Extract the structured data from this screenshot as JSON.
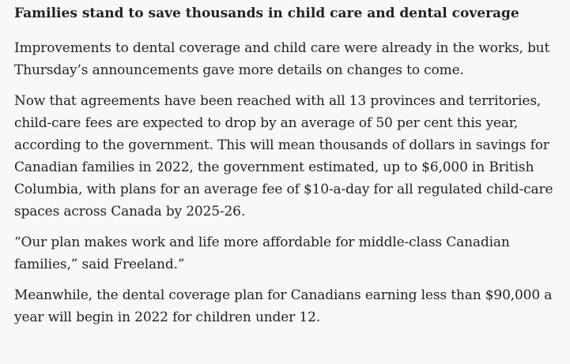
{
  "article": {
    "heading": "Families stand to save thousands in child care and dental coverage",
    "paragraphs": [
      {
        "lines": [
          "Improvements to dental coverage and child care were already in the works, but",
          "Thursday’s announcements gave more details on changes to come."
        ]
      },
      {
        "lines": [
          "Now that agreements have been reached with all 13 provinces and territories,",
          "child-care fees are expected to drop by an average of 50 per cent this year,",
          "according to the government. This will mean thousands of dollars in savings for",
          "Canadian families in 2022, the government estimated, up to $6,000 in British",
          "Columbia, with plans for an average fee of $10-a-day for all regulated child-care",
          "spaces across Canada by 2025-26."
        ]
      },
      {
        "lines": [
          "“Our plan makes work and life more affordable for middle-class Canadian",
          "families,” said Freeland.”"
        ]
      },
      {
        "lines": [
          "Meanwhile, the dental coverage plan for Canadians earning less than $90,000 a",
          "year will begin in 2022 for children under 12."
        ]
      }
    ]
  }
}
